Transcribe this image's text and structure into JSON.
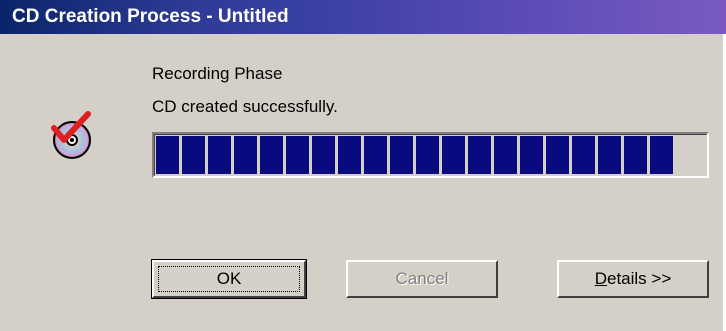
{
  "window": {
    "title": "CD Creation Process - Untitled"
  },
  "status": {
    "phase": "Recording Phase",
    "message": "CD created successfully.",
    "progress_fraction": 1.0,
    "progress_block_count": 20
  },
  "icon": {
    "name": "cd-checkmark-icon"
  },
  "buttons": {
    "ok_label": "OK",
    "cancel_label": "Cancel",
    "details_label": "Details >>"
  },
  "colors": {
    "title_bar_start": "#0a246a",
    "title_bar_end": "#7a5ac0",
    "progress_block": "#0a0a80",
    "dialog_background": "#d4d0c8"
  }
}
